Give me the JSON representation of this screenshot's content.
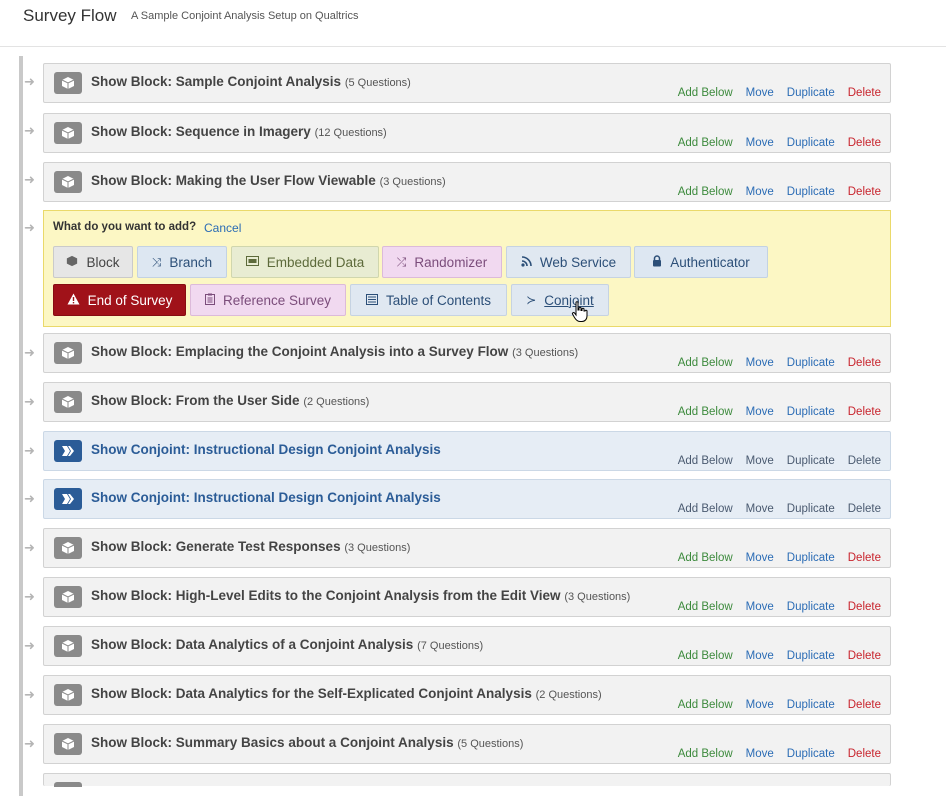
{
  "header": {
    "title": "Survey Flow",
    "subtitle": "A Sample Conjoint Analysis Setup on Qualtrics"
  },
  "actions": {
    "add_below": "Add Below",
    "move": "Move",
    "duplicate": "Duplicate",
    "delete": "Delete"
  },
  "elements_top": [
    {
      "title": "Show Block: Sample Conjoint Analysis",
      "count": "(5 Questions)"
    },
    {
      "title": "Show Block: Sequence in Imagery",
      "count": "(12 Questions)"
    },
    {
      "title": "Show Block: Making the User Flow Viewable",
      "count": "(3 Questions)"
    }
  ],
  "add_panel": {
    "prompt": "What do you want to add?",
    "cancel": "Cancel",
    "options": {
      "block": "Block",
      "branch": "Branch",
      "embedded_data": "Embedded Data",
      "randomizer": "Randomizer",
      "web_service": "Web Service",
      "authenticator": "Authenticator",
      "end_of_survey": "End of Survey",
      "reference_survey": "Reference Survey",
      "table_of_contents": "Table of Contents",
      "conjoint": "Conjoint"
    }
  },
  "elements_bottom": [
    {
      "title": "Show Block: Emplacing the Conjoint Analysis into a Survey Flow",
      "count": "(3 Questions)"
    },
    {
      "title": "Show Block: From the User Side",
      "count": "(2 Questions)"
    },
    {
      "title": "Show Conjoint: Instructional Design Conjoint Analysis",
      "count": ""
    },
    {
      "title": "Show Conjoint: Instructional Design Conjoint Analysis",
      "count": ""
    },
    {
      "title": "Show Block: Generate Test Responses",
      "count": "(3 Questions)"
    },
    {
      "title": "Show Block: High-Level Edits to the Conjoint Analysis from the Edit View",
      "count": "(3 Questions)"
    },
    {
      "title": "Show Block: Data Analytics of a Conjoint Analysis",
      "count": "(7 Questions)"
    },
    {
      "title": "Show Block: Data Analytics for the Self-Explicated Conjoint Analysis",
      "count": "(2 Questions)"
    },
    {
      "title": "Show Block: Summary Basics about a Conjoint Analysis",
      "count": "(5 Questions)"
    }
  ]
}
